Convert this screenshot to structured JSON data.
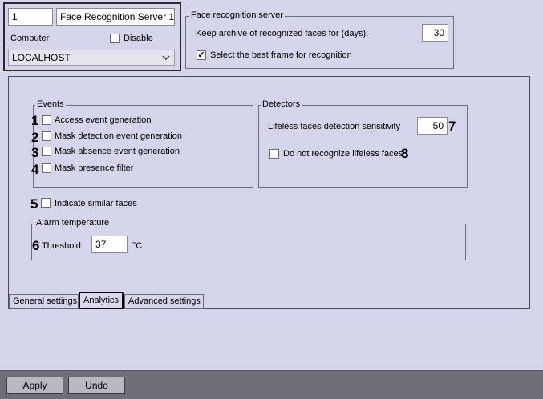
{
  "object": {
    "id": "1",
    "name": "Face Recognition Server 1",
    "computer_label": "Computer",
    "disable_label": "Disable",
    "disable_checked": false,
    "computer_value": "LOCALHOST"
  },
  "server_group": {
    "title": "Face recognition server",
    "archive_label": "Keep archive of recognized faces for (days):",
    "archive_value": "30",
    "best_frame_label": "Select the best frame for recognition",
    "best_frame_checked": true
  },
  "events": {
    "title": "Events",
    "items": [
      {
        "num": "1",
        "label": "Access event generation",
        "checked": false
      },
      {
        "num": "2",
        "label": "Mask detection event generation",
        "checked": false
      },
      {
        "num": "3",
        "label": "Mask absence event generation",
        "checked": false
      },
      {
        "num": "4",
        "label": "Mask presence filter",
        "checked": false
      }
    ]
  },
  "detectors": {
    "title": "Detectors",
    "sensitivity_label": "Lifeless faces detection sensitivity",
    "sensitivity_value": "50",
    "sensitivity_num": "7",
    "lifeless_label": "Do not recognize lifeless faces",
    "lifeless_checked": false,
    "lifeless_num": "8"
  },
  "similar": {
    "num": "5",
    "label": "Indicate similar faces",
    "checked": false
  },
  "alarm": {
    "title": "Alarm temperature",
    "num": "6",
    "threshold_label": "Threshold:",
    "threshold_value": "37",
    "unit": "°C"
  },
  "tabs": [
    {
      "label": "General settings",
      "active": false
    },
    {
      "label": "Analytics",
      "active": true
    },
    {
      "label": "Advanced settings",
      "active": false
    }
  ],
  "buttons": {
    "apply": "Apply",
    "undo": "Undo"
  }
}
